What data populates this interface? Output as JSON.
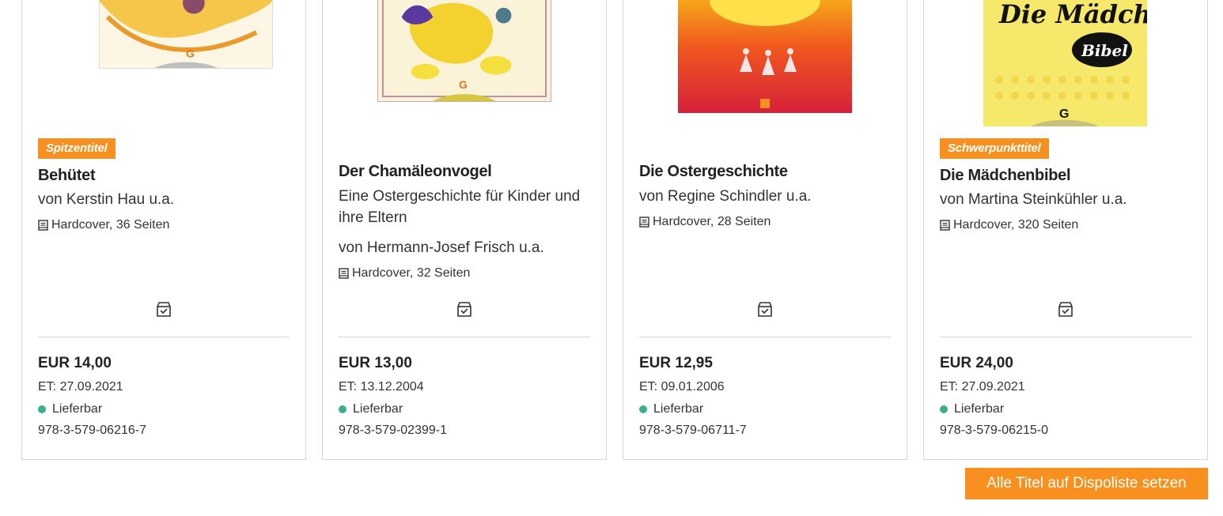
{
  "colors": {
    "accent": "#f7901e",
    "available_dot": "#3bb08f",
    "border": "#d6d6d6",
    "text": "#222222"
  },
  "products": [
    {
      "badge": "Spitzentitel",
      "title": "Behütet",
      "subtitle": "",
      "author": "von Kerstin Hau u.a.",
      "format": "Hardcover, 36 Seiten",
      "format_icon": "book-icon",
      "dispo_icon": "dispo-box-check-icon",
      "price": "EUR 14,00",
      "release_date": "ET: 27.09.2021",
      "availability": "Lieferbar",
      "isbn": "978-3-579-06216-7"
    },
    {
      "badge": "",
      "title": "Der Chamäleonvogel",
      "subtitle": "Eine Ostergeschichte für Kinder und ihre Eltern",
      "author": "von Hermann-Josef Frisch u.a.",
      "format": "Hardcover, 32 Seiten",
      "format_icon": "book-icon",
      "dispo_icon": "dispo-box-check-icon",
      "price": "EUR 13,00",
      "release_date": "ET: 13.12.2004",
      "availability": "Lieferbar",
      "isbn": "978-3-579-02399-1"
    },
    {
      "badge": "",
      "title": "Die Ostergeschichte",
      "subtitle": "",
      "author": "von Regine Schindler u.a.",
      "format": "Hardcover, 28 Seiten",
      "format_icon": "book-icon",
      "dispo_icon": "dispo-box-check-icon",
      "price": "EUR 12,95",
      "release_date": "ET: 09.01.2006",
      "availability": "Lieferbar",
      "isbn": "978-3-579-06711-7"
    },
    {
      "badge": "Schwerpunkttitel",
      "title": "Die Mädchenbibel",
      "subtitle": "",
      "author": "von Martina Steinkühler u.a.",
      "format": "Hardcover, 320 Seiten",
      "format_icon": "book-icon",
      "dispo_icon": "dispo-box-check-icon",
      "price": "EUR 24,00",
      "release_date": "ET: 27.09.2021",
      "availability": "Lieferbar",
      "isbn": "978-3-579-06215-0",
      "cover_text": "Die Mädchen Bibel"
    }
  ],
  "actions": {
    "add_all_label": "Alle Titel auf Dispoliste setzen"
  }
}
